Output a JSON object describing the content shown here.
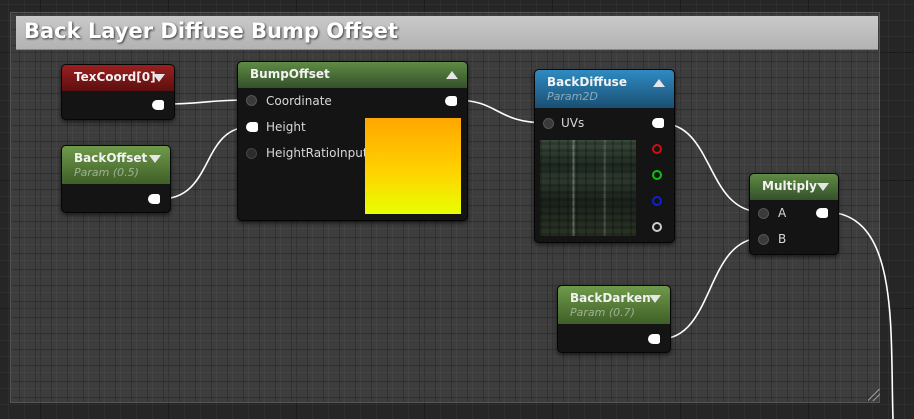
{
  "comment": {
    "title": "Back Layer Diffuse Bump Offset"
  },
  "nodes": {
    "texcoord": {
      "title": "TexCoord[0]"
    },
    "backoffset": {
      "title": "BackOffset",
      "subtitle": "Param (0.5)"
    },
    "bumpoffset": {
      "title": "BumpOffset",
      "inputs": [
        "Coordinate",
        "Height",
        "HeightRatioInput"
      ]
    },
    "backdiffuse": {
      "title": "BackDiffuse",
      "subtitle": "Param2D",
      "inputs": [
        "UVs"
      ]
    },
    "multiply": {
      "title": "Multiply",
      "inputs": [
        "A",
        "B"
      ]
    },
    "backdarken": {
      "title": "BackDarken",
      "subtitle": "Param (0.7)"
    }
  },
  "colors": {
    "pin_red": "#cc1010",
    "pin_green": "#10c010",
    "pin_blue": "#1020d0",
    "pin_gray": "#cccccc",
    "wire": "#ffffff"
  }
}
